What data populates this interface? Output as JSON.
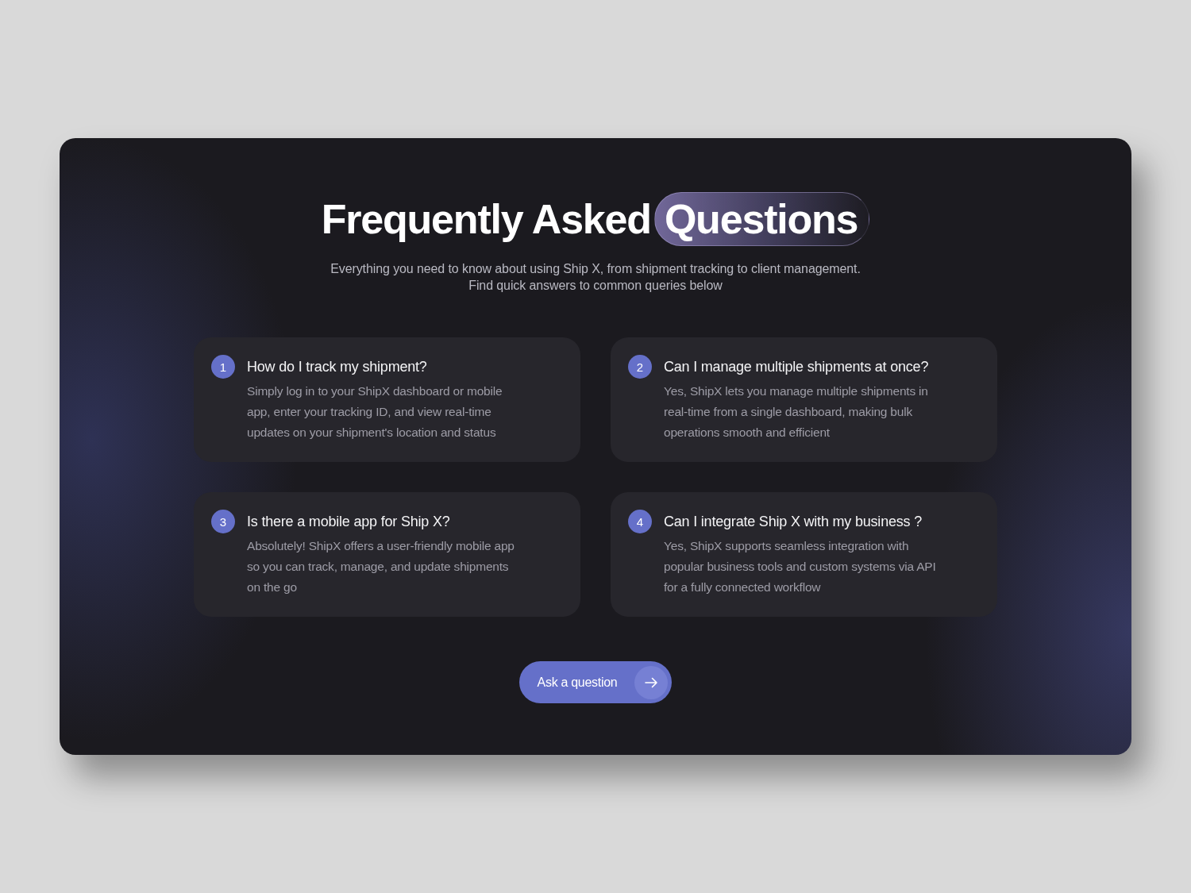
{
  "heading": {
    "text": "Frequently Asked",
    "highlight": "Questions"
  },
  "subtitle": "Everything you need to know about using Ship X, from shipment tracking to client management.\nFind quick answers to common queries below",
  "faqs": [
    {
      "number": "1",
      "question": "How do I track my shipment?",
      "answer": "Simply log in to your ShipX dashboard or mobile app, enter your tracking ID, and view real-time updates on your shipment's location and status"
    },
    {
      "number": "2",
      "question": "Can I manage multiple shipments at once?",
      "answer": "Yes, ShipX lets you manage multiple shipments in real-time from a single dashboard, making bulk operations smooth and efficient"
    },
    {
      "number": "3",
      "question": "Is there a mobile app for Ship X?",
      "answer": "Absolutely! ShipX offers a user-friendly mobile app so you can track, manage, and update shipments on the go"
    },
    {
      "number": "4",
      "question": "Can I integrate Ship X with my business ?",
      "answer": "Yes, ShipX supports seamless integration with popular business tools and custom systems via API for a fully connected workflow"
    }
  ],
  "cta": {
    "label": "Ask a question"
  }
}
